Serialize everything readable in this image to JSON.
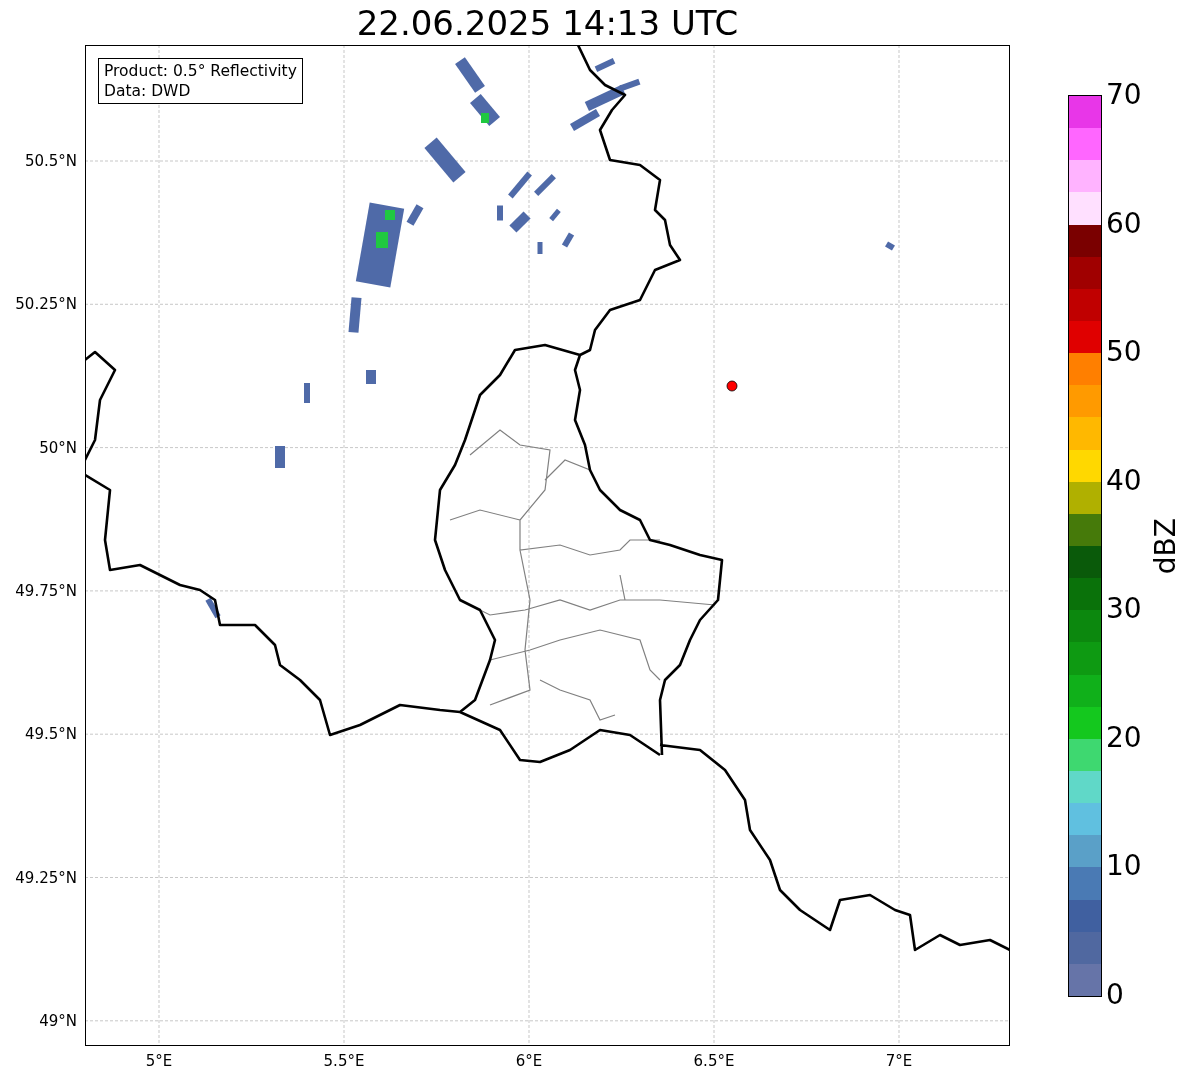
{
  "title": "22.06.2025 14:13 UTC",
  "info_box": [
    "Product: 0.5° Reflectivity",
    "Data: DWD"
  ],
  "x_ticks": [
    "5°E",
    "5.5°E",
    "6°E",
    "6.5°E",
    "7°E"
  ],
  "y_ticks": [
    "50.5°N",
    "50.25°N",
    "50°N",
    "49.75°N",
    "49.5°N",
    "49.25°N",
    "49°N"
  ],
  "colorbar": {
    "label": "dBZ",
    "ticks": [
      "70",
      "60",
      "50",
      "40",
      "30",
      "20",
      "10",
      "0"
    ],
    "bins": [
      {
        "color": "#e836e8"
      },
      {
        "color": "#ff66ff"
      },
      {
        "color": "#ffb3ff"
      },
      {
        "color": "#ffe0ff"
      },
      {
        "color": "#7a0000"
      },
      {
        "color": "#a00000"
      },
      {
        "color": "#c00000"
      },
      {
        "color": "#e00000"
      },
      {
        "color": "#ff7f00"
      },
      {
        "color": "#ff9a00"
      },
      {
        "color": "#ffb800"
      },
      {
        "color": "#ffd800"
      },
      {
        "color": "#b0b000"
      },
      {
        "color": "#467a0a"
      },
      {
        "color": "#0a5a0a"
      },
      {
        "color": "#0a720a"
      },
      {
        "color": "#0c880e"
      },
      {
        "color": "#0e9a12"
      },
      {
        "color": "#10b01a"
      },
      {
        "color": "#14c81e"
      },
      {
        "color": "#3ed870"
      },
      {
        "color": "#60d8c8"
      },
      {
        "color": "#60c0e0"
      },
      {
        "color": "#5aa0c8"
      },
      {
        "color": "#4a7ab4"
      },
      {
        "color": "#4060a0"
      },
      {
        "color": "#5068a0"
      },
      {
        "color": "#6674a8"
      }
    ]
  }
}
